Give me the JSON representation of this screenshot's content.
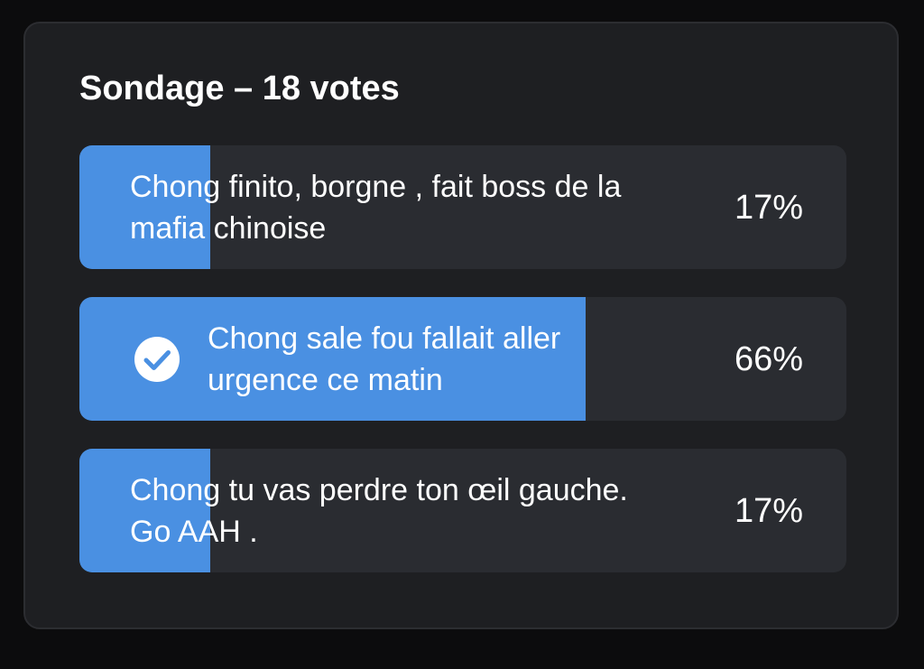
{
  "poll": {
    "title": "Sondage – 18 votes",
    "accent_color": "#4a90e2",
    "options": [
      {
        "label": "Chong finito, borgne , fait boss de la mafia chinoise",
        "percent_label": "17%",
        "percent": 17,
        "selected": false
      },
      {
        "label": "Chong sale fou fallait aller urgence ce matin",
        "percent_label": "66%",
        "percent": 66,
        "selected": true,
        "icon": "check-circle-icon"
      },
      {
        "label": "Chong tu vas perdre ton œil gauche. Go AAH .",
        "percent_label": "17%",
        "percent": 17,
        "selected": false
      }
    ]
  }
}
